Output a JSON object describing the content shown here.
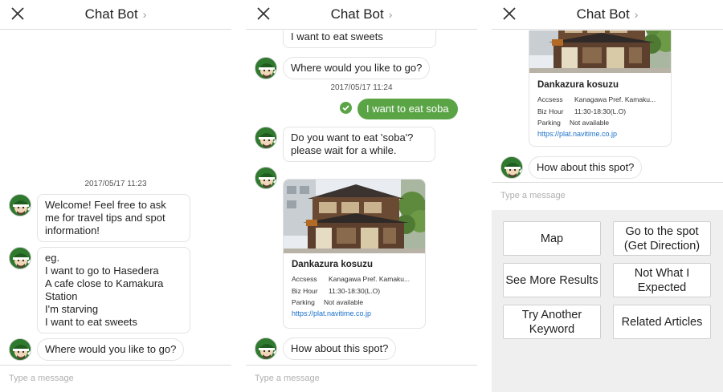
{
  "header": {
    "title": "Chat Bot",
    "chevron": "›",
    "close_icon": "close-icon"
  },
  "input": {
    "placeholder": "Type a message"
  },
  "colors": {
    "user_bubble": "#5aa446",
    "link": "#1a70c9",
    "quick_bg": "#efefef"
  },
  "panel1": {
    "timestamp": "2017/05/17 11:23",
    "bot_msg_1": "Welcome! Feel free to ask\nme for travel tips and spot\ninformation!",
    "bot_msg_2": "eg.\n I want to go to Hasedera\n A cafe close to Kamakura\nStation\n I'm starving\n I want to eat sweets",
    "bot_msg_3": "Where would you like to go?"
  },
  "panel2": {
    "partial_msg": "I'm starving\n I want to eat sweets",
    "bot_msg_1": "Where would you like to go?",
    "timestamp": "2017/05/17 11:24",
    "user_msg": "I want to eat soba",
    "bot_msg_2": "Do you want to eat 'soba'?\nplease wait for a while.",
    "bot_msg_3": "How about this spot?"
  },
  "spot_card": {
    "name": "Dankazura kosuzu",
    "access_label": "Accsess",
    "access_value": "Kanagawa Pref. Kamaku...",
    "hours_label": "Biz Hour",
    "hours_value": "11:30-18:30(L.O)",
    "parking_label": "Parking",
    "parking_value": "Not available",
    "link": "https://plat.navitime.co.jp"
  },
  "panel3": {
    "bot_msg": "How about this spot?",
    "quick_replies": [
      {
        "label": "Map"
      },
      {
        "label": "Go to the spot\n(Get Direction)"
      },
      {
        "label": "See More Results"
      },
      {
        "label": "Not What I\nExpected"
      },
      {
        "label": "Try Another\nKeyword"
      },
      {
        "label": "Related Articles"
      }
    ]
  }
}
